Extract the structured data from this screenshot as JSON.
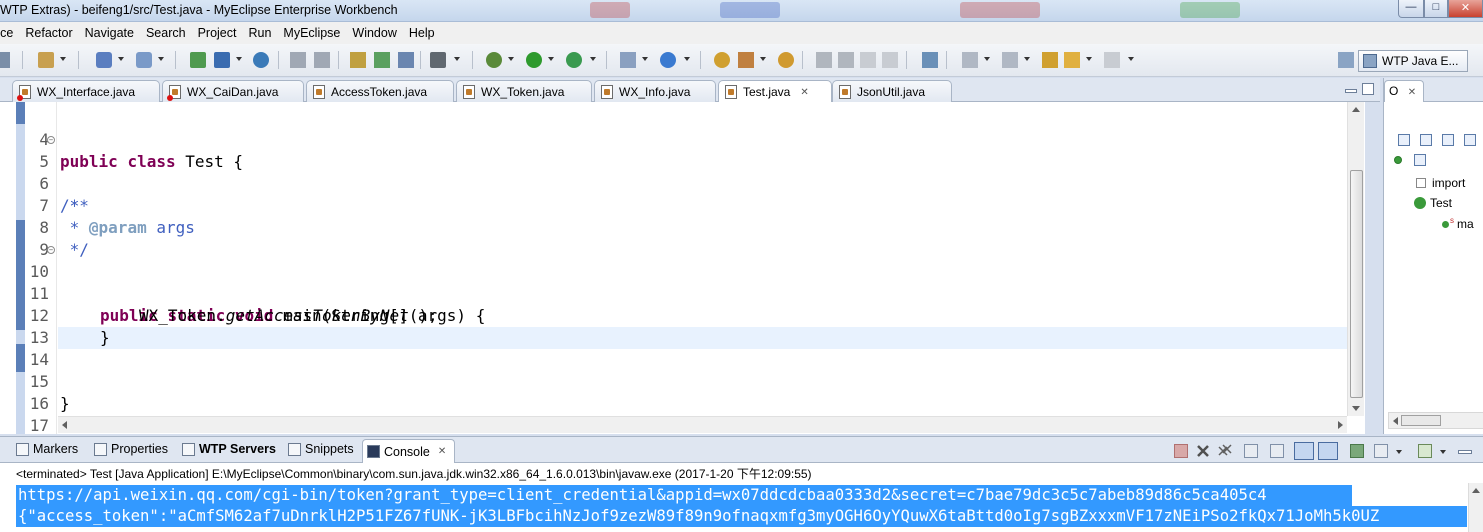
{
  "window": {
    "title": "WTP Extras) - beifeng1/src/Test.java - MyEclipse Enterprise Workbench",
    "minimize_glyph": "—",
    "maximize_glyph": "□",
    "close_glyph": "✕"
  },
  "menu": [
    "rce",
    "Refactor",
    "Navigate",
    "Search",
    "Project",
    "Run",
    "MyEclipse",
    "Window",
    "Help"
  ],
  "perspective": {
    "label": "WTP Java E..."
  },
  "editor_tabs": [
    {
      "label": "WX_Interface.java",
      "error": true
    },
    {
      "label": "WX_CaiDan.java",
      "error": true
    },
    {
      "label": "AccessToken.java",
      "error": false
    },
    {
      "label": "WX_Token.java",
      "error": false
    },
    {
      "label": "WX_Info.java",
      "error": false
    },
    {
      "label": "Test.java",
      "error": false,
      "active": true,
      "close": "✕"
    },
    {
      "label": "JsonUtil.java",
      "error": false
    }
  ],
  "code": {
    "line_numbers": [
      "4",
      "5",
      "6",
      "7",
      "8",
      "9",
      "10",
      "11",
      "12",
      "13",
      "14",
      "15",
      "16",
      "17"
    ],
    "line4": {
      "kw1": "public",
      "kw2": "class",
      "rest": " Test {"
    },
    "line5": "/**",
    "line6": " *",
    "line7": {
      "pre": " * ",
      "tag": "@param",
      "rest": " args"
    },
    "line8": " */",
    "line10": {
      "kw1": "public",
      "kw2": "static",
      "kw3": "void",
      "rest": " main(String[] args) {"
    },
    "line11": {
      "pre": "WX_Token.",
      "method": "getAccessTokenByNet",
      "rest": "();"
    },
    "line12": "}",
    "line15": "}"
  },
  "outline": {
    "tab_label": "O",
    "tab_close": "✕",
    "items": [
      "import",
      "Test",
      "ma"
    ],
    "main_superscript": "s"
  },
  "bottom": {
    "tabs": [
      "Markers",
      "Properties",
      "WTP Servers",
      "Snippets",
      "Console"
    ],
    "console_close": "✕",
    "terminated": "<terminated> Test [Java Application] E:\\MyEclipse\\Common\\binary\\com.sun.java.jdk.win32.x86_64_1.6.0.013\\bin\\javaw.exe (2017-1-20 下午12:09:55)",
    "output_lines": [
      "https://api.weixin.qq.com/cgi-bin/token?grant_type=client_credential&appid=wx07ddcdcbaa0333d2&secret=c7bae79dc3c5c7abeb89d86c5ca405c4",
      "{\"access_token\":\"aCmfSM62af7uDnrklH2P51FZ67fUNK-jK3LBFbcihNzJof9zezW89f89n9ofnaqxmfg3myOGH6OyYQuwX6taBttd0oIg7sgBZxxxmVF17zNEiPSo2fkQx71JoMh5k0UZ"
    ]
  }
}
